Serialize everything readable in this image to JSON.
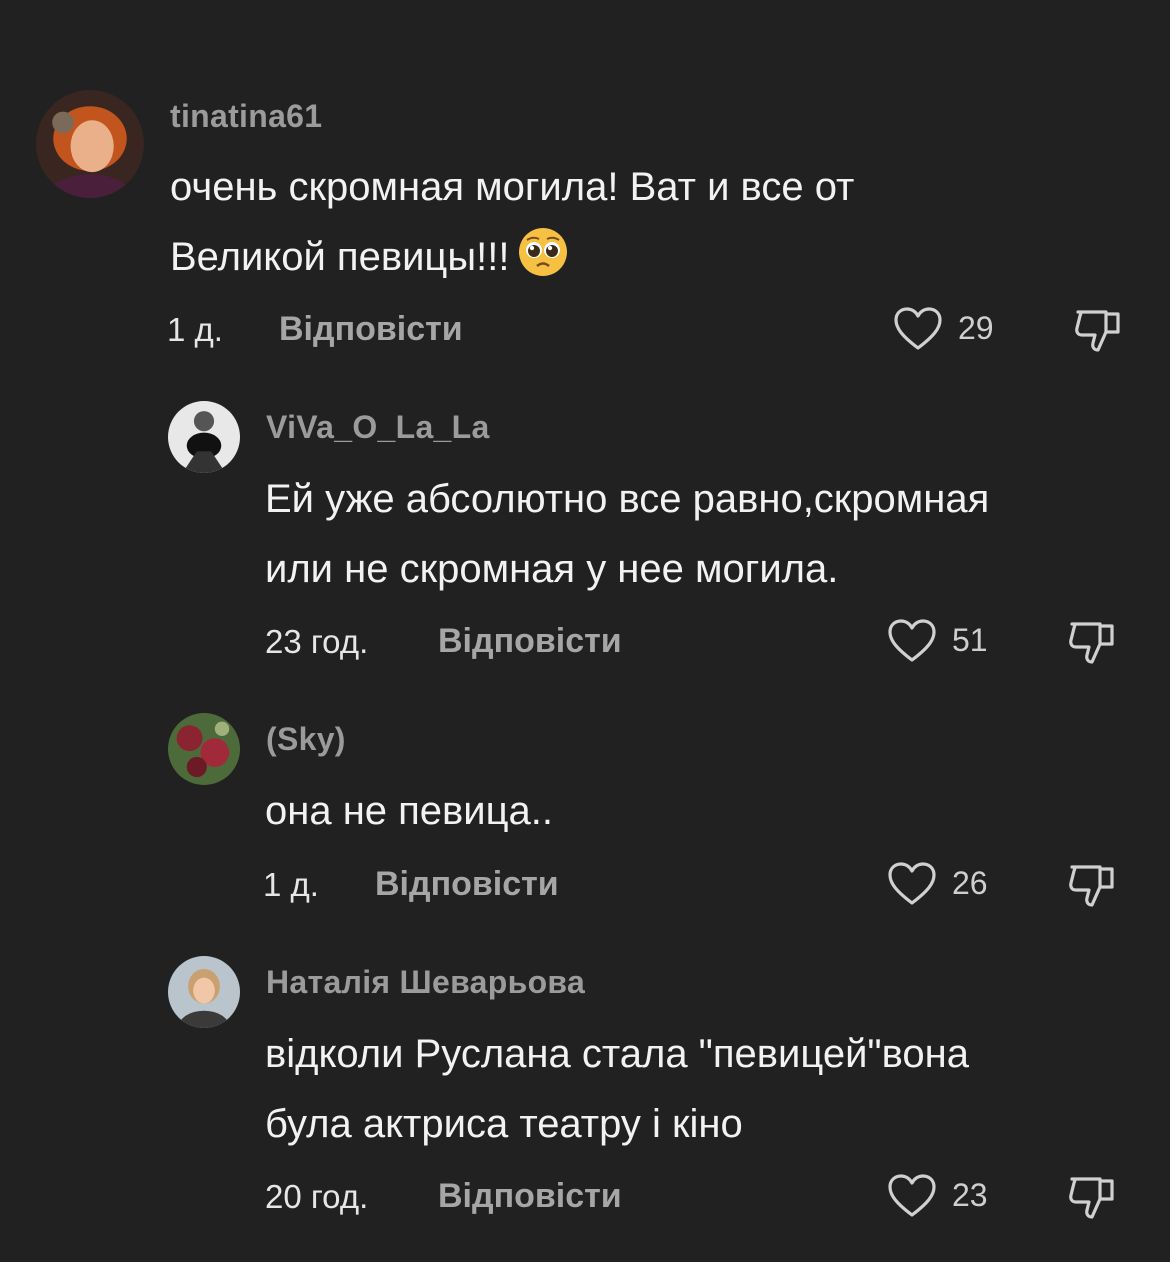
{
  "comments": [
    {
      "username": "tinatina61",
      "lines": [
        "очень скромная могила! Ват и все от",
        "Великой певицы!!!"
      ],
      "emoji": "pleading-face-emoji",
      "time": "1 д.",
      "reply_label": "Відповісти",
      "likes": "29"
    },
    {
      "username": "ViVa_O_La_La",
      "lines": [
        "Ей уже абсолютно все равно,скромная",
        "или не скромная у нее могила."
      ],
      "time": "23 год.",
      "reply_label": "Відповісти",
      "likes": "51"
    },
    {
      "username": "(Sky)",
      "lines": [
        "она не певица.."
      ],
      "time": "1 д.",
      "reply_label": "Відповісти",
      "likes": "26"
    },
    {
      "username": "Наталія Шеварьова",
      "lines": [
        "відколи Руслана стала \"певицей\"вона",
        "була актриса театру і кіно"
      ],
      "time": "20 год.",
      "reply_label": "Відповісти",
      "likes": "23"
    }
  ],
  "icons": {
    "like": "heart-outline-icon",
    "dislike": "thumbs-down-outline-icon"
  },
  "colors": {
    "background": "#212121",
    "username": "#9b9b9b",
    "text": "#f2f2f2"
  }
}
